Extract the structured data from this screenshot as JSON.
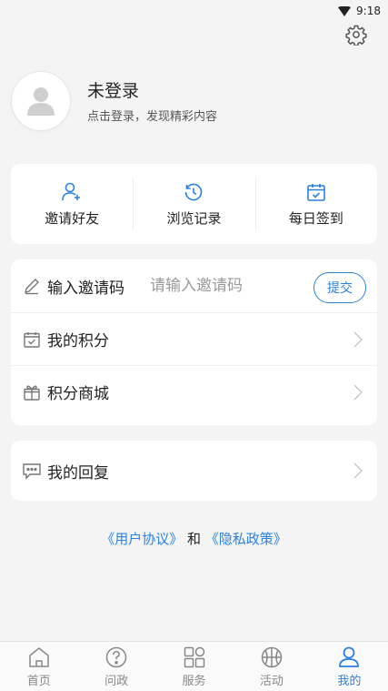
{
  "status_bar": {
    "time": "9:18"
  },
  "profile": {
    "name": "未登录",
    "subtitle": "点击登录，发现精彩内容"
  },
  "quick_actions": [
    {
      "label": "邀请好友",
      "icon": "add-user-icon"
    },
    {
      "label": "浏览记录",
      "icon": "history-icon"
    },
    {
      "label": "每日签到",
      "icon": "calendar-check-icon"
    }
  ],
  "invite": {
    "label": "输入邀请码",
    "placeholder": "请输入邀请码",
    "submit_label": "提交"
  },
  "menu": {
    "my_points": "我的积分",
    "points_mall": "积分商城",
    "my_replies": "我的回复"
  },
  "agreement": {
    "user_agreement": "《用户协议》",
    "and": "和",
    "privacy_policy": "《隐私政策》"
  },
  "tabs": [
    {
      "label": "首页",
      "icon": "home-icon",
      "active": false
    },
    {
      "label": "问政",
      "icon": "question-icon",
      "active": false
    },
    {
      "label": "服务",
      "icon": "grid-icon",
      "active": false
    },
    {
      "label": "活动",
      "icon": "basketball-icon",
      "active": false
    },
    {
      "label": "我的",
      "icon": "user-icon",
      "active": true
    }
  ],
  "colors": {
    "accent": "#2b82dd",
    "background": "#f4f4f4",
    "card": "#ffffff"
  }
}
